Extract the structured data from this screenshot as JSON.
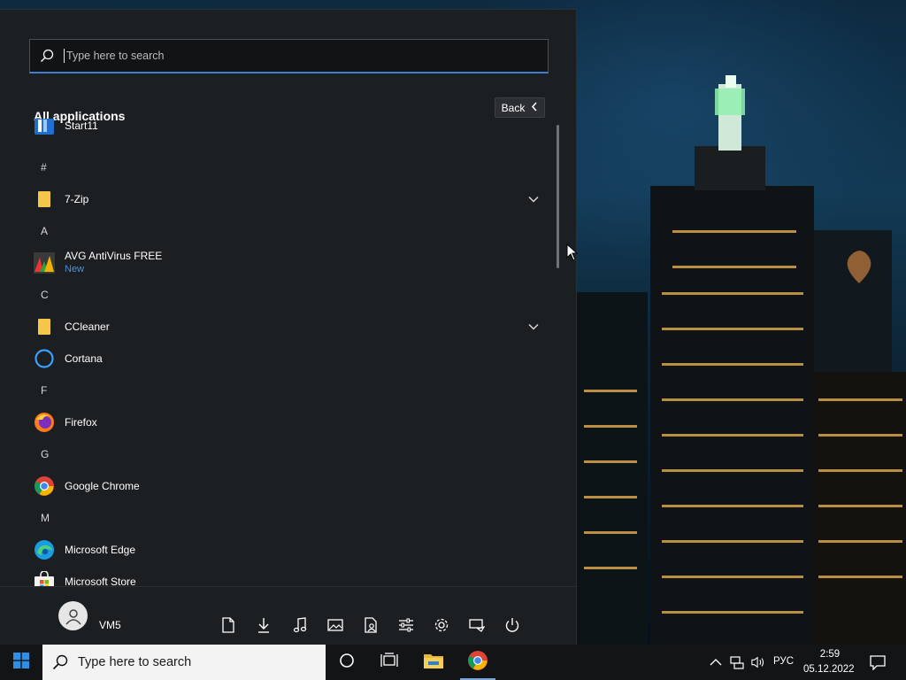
{
  "start_menu": {
    "search": {
      "placeholder": "Type here to search"
    },
    "header_title": "All applications",
    "back_label": "Back",
    "apps": [
      {
        "kind": "app",
        "name": "Start11",
        "icon": "start11-icon"
      },
      {
        "kind": "letter",
        "name": "#"
      },
      {
        "kind": "folder",
        "name": "7-Zip",
        "icon": "folder-icon"
      },
      {
        "kind": "letter",
        "name": "A"
      },
      {
        "kind": "app",
        "name": "AVG AntiVirus FREE",
        "subtitle": "New",
        "icon": "avg-icon"
      },
      {
        "kind": "letter",
        "name": "C"
      },
      {
        "kind": "folder",
        "name": "CCleaner",
        "icon": "folder-icon"
      },
      {
        "kind": "app",
        "name": "Cortana",
        "icon": "cortana-icon"
      },
      {
        "kind": "letter",
        "name": "F"
      },
      {
        "kind": "app",
        "name": "Firefox",
        "icon": "firefox-icon"
      },
      {
        "kind": "letter",
        "name": "G"
      },
      {
        "kind": "app",
        "name": "Google Chrome",
        "icon": "chrome-icon"
      },
      {
        "kind": "letter",
        "name": "M"
      },
      {
        "kind": "app",
        "name": "Microsoft Edge",
        "icon": "edge-icon"
      },
      {
        "kind": "app",
        "name": "Microsoft Store",
        "icon": "store-icon"
      }
    ],
    "user": {
      "name": "VM5"
    },
    "bottom_icons": [
      "document-icon",
      "downloads-icon",
      "music-icon",
      "pictures-icon",
      "personal-folder-icon",
      "settings-sliders-icon",
      "gear-icon",
      "network-icon",
      "power-icon"
    ]
  },
  "taskbar": {
    "search_text": "Type here to search",
    "pinned": [
      "cortana-circle-icon",
      "task-view-icon",
      "file-explorer-icon",
      "chrome-icon"
    ],
    "tray": {
      "language": "РУС",
      "time": "2:59",
      "date": "05.12.2022"
    }
  },
  "colors": {
    "accent": "#3f7fcf",
    "menu_bg": "#1c1f22",
    "taskbar_bg": "#121416",
    "subtitle_blue": "#4e8ed8"
  }
}
